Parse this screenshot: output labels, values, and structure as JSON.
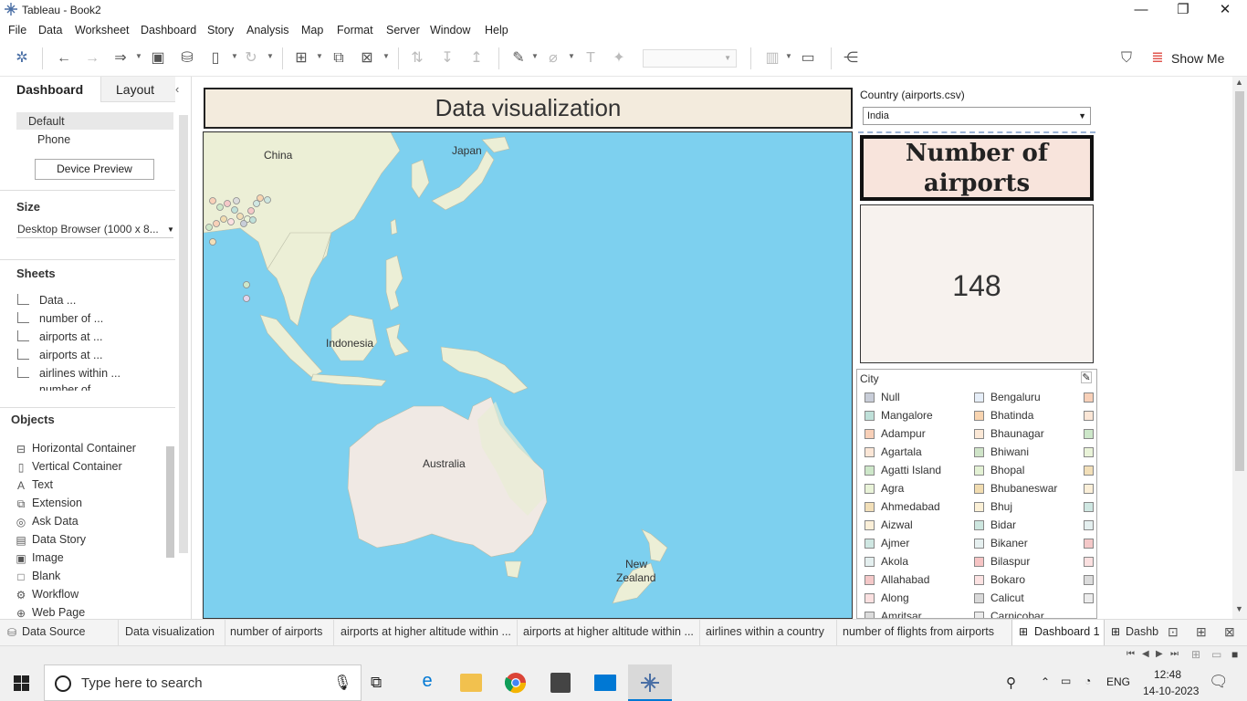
{
  "window": {
    "title": "Tableau - Book2"
  },
  "menu": [
    "File",
    "Data",
    "Worksheet",
    "Dashboard",
    "Story",
    "Analysis",
    "Map",
    "Format",
    "Server",
    "Window",
    "Help"
  ],
  "toolbar": {
    "show_me": "Show Me"
  },
  "left_pane": {
    "tabs": [
      "Dashboard",
      "Layout"
    ],
    "devices": [
      "Default",
      "Phone"
    ],
    "device_preview": "Device Preview",
    "size_heading": "Size",
    "size_value": "Desktop Browser (1000 x 8...",
    "sheets_heading": "Sheets",
    "sheets": [
      "Data ...",
      "number of ...",
      "airports at ...",
      "airports at ...",
      "airlines within ...",
      "number of ..."
    ],
    "objects_heading": "Objects",
    "objects": [
      {
        "label": "Horizontal Container",
        "icon": "horizontal-container-icon",
        "glyph": "⊟"
      },
      {
        "label": "Vertical Container",
        "icon": "vertical-container-icon",
        "glyph": "▯"
      },
      {
        "label": "Text",
        "icon": "text-icon",
        "glyph": "A"
      },
      {
        "label": "Extension",
        "icon": "extension-icon",
        "glyph": "⧉"
      },
      {
        "label": "Ask Data",
        "icon": "ask-data-icon",
        "glyph": "◎"
      },
      {
        "label": "Data Story",
        "icon": "data-story-icon",
        "glyph": "▤"
      },
      {
        "label": "Image",
        "icon": "image-icon",
        "glyph": "▣"
      },
      {
        "label": "Blank",
        "icon": "blank-icon",
        "glyph": "□"
      },
      {
        "label": "Workflow",
        "icon": "workflow-icon",
        "glyph": "⚙"
      },
      {
        "label": "Web Page",
        "icon": "web-page-icon",
        "glyph": "⊕"
      }
    ]
  },
  "dashboard": {
    "title": "Data visualization",
    "map_labels": [
      "China",
      "Japan",
      "Indonesia",
      "Australia",
      "New",
      "Zealand"
    ],
    "filter": {
      "label": "Country (airports.csv)",
      "value": "India"
    },
    "kpi": {
      "title_line1": "Number of",
      "title_line2": "airports",
      "value": "148"
    },
    "legend": {
      "title": "City",
      "col1": [
        {
          "name": "Null",
          "color": "#c8cdd8"
        },
        {
          "name": "Mangalore",
          "color": "#bfe0d9"
        },
        {
          "name": "Adampur",
          "color": "#f8d0b8"
        },
        {
          "name": "Agartala",
          "color": "#fbe6d6"
        },
        {
          "name": "Agatti Island",
          "color": "#cde7c9"
        },
        {
          "name": "Agra",
          "color": "#e9f3d8"
        },
        {
          "name": "Ahmedabad",
          "color": "#f2dfb8"
        },
        {
          "name": "Aizwal",
          "color": "#fbefd8"
        },
        {
          "name": "Ajmer",
          "color": "#cfe7e2"
        },
        {
          "name": "Akola",
          "color": "#e4efef"
        },
        {
          "name": "Allahabad",
          "color": "#f4c8c8"
        },
        {
          "name": "Along",
          "color": "#fbe0e0"
        },
        {
          "name": "Amritsar",
          "color": "#dcdcdc"
        }
      ],
      "col2": [
        {
          "name": "Bengaluru",
          "color": "#e6eef8"
        },
        {
          "name": "Bhatinda",
          "color": "#f8d4b0"
        },
        {
          "name": "Bhaunagar",
          "color": "#fbe8d6"
        },
        {
          "name": "Bhiwani",
          "color": "#cfe4c8"
        },
        {
          "name": "Bhopal",
          "color": "#e3f1d4"
        },
        {
          "name": "Bhubaneswar",
          "color": "#f1dcb0"
        },
        {
          "name": "Bhuj",
          "color": "#fbf0d6"
        },
        {
          "name": "Bidar",
          "color": "#cde6df"
        },
        {
          "name": "Bikaner",
          "color": "#e6f0f0"
        },
        {
          "name": "Bilaspur",
          "color": "#f6c4c4"
        },
        {
          "name": "Bokaro",
          "color": "#fce2e2"
        },
        {
          "name": "Calicut",
          "color": "#d9d9d9"
        },
        {
          "name": "Carnicobar",
          "color": "#ececec"
        }
      ]
    }
  },
  "tabs": [
    "Data Source",
    "Data visualization",
    "number of airports",
    "airports at higher altitude within ...",
    "airports at higher altitude within ...",
    "airlines within a country",
    "number of flights from airports",
    "Dashboard 1",
    "Dashb"
  ],
  "taskbar": {
    "search_placeholder": "Type here to search",
    "lang": "ENG",
    "time": "12:48",
    "date": "14-10-2023"
  }
}
